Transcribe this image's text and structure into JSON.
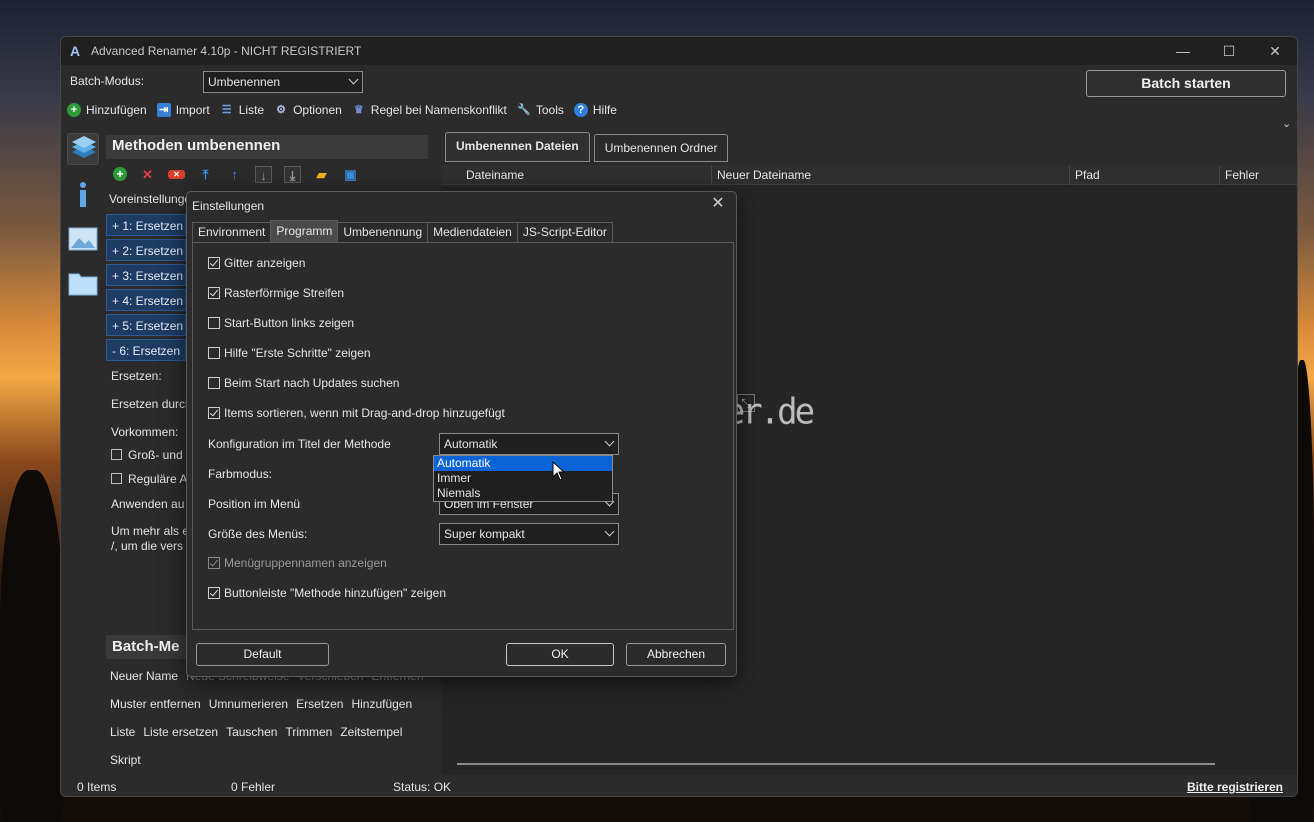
{
  "window": {
    "title": "Advanced Renamer 4.10p - NICHT REGISTRIERT",
    "controls": {
      "minimize": "—",
      "maximize": "☐",
      "close": "✕"
    }
  },
  "batch_mode": {
    "label": "Batch-Modus:",
    "value": "Umbenennen"
  },
  "batch_start_label": "Batch starten",
  "toolbar": [
    {
      "label": "Hinzufügen",
      "icon": "plus-circle-icon",
      "color": "#2e9b3a"
    },
    {
      "label": "Import",
      "icon": "import-icon",
      "color": "#3a7fd6"
    },
    {
      "label": "Liste",
      "icon": "list-icon",
      "color": "#3a7fd6"
    },
    {
      "label": "Optionen",
      "icon": "gear-icon",
      "color": "#8aa0c8"
    },
    {
      "label": "Regel bei Namenskonflikt",
      "icon": "rule-icon",
      "color": "#6a8fd0"
    },
    {
      "label": "Tools",
      "icon": "wrench-icon",
      "color": "#a0a0a0"
    },
    {
      "label": "Hilfe",
      "icon": "help-icon",
      "color": "#2f7fe0"
    }
  ],
  "methods_panel": {
    "header": "Methoden umbenennen",
    "presets_label": "Voreinstellunge",
    "method_rows": [
      "+ 1: Ersetzen",
      "+ 2: Ersetzen",
      "+ 3: Ersetzen",
      "+ 4: Ersetzen",
      "+ 5: Ersetzen",
      "- 6: Ersetzen"
    ],
    "fields": {
      "replace": "Ersetzen:",
      "replace_with": "Ersetzen durch",
      "occurrences": "Vorkommen:",
      "case_sensitive": "Groß- und",
      "regex": "Reguläre A",
      "apply_to": "Anwenden au",
      "hint_line1": "Um mehr als e",
      "hint_line2": "/, um die vers"
    }
  },
  "batch_methods": {
    "header": "Batch-Me",
    "rows": [
      [
        "Neuer Name",
        "Neue Schreibweise",
        "Verschieben",
        "Entfernen"
      ],
      [
        "Muster entfernen",
        "Umnumerieren",
        "Ersetzen",
        "Hinzufügen"
      ],
      [
        "Liste",
        "Liste ersetzen",
        "Tauschen",
        "Trimmen",
        "Zeitstempel"
      ],
      [
        "Skript"
      ]
    ]
  },
  "right_tabs": [
    "Umbenennen Dateien",
    "Umbenennen Ordner"
  ],
  "list_columns": [
    "Dateiname",
    "Neuer Dateiname",
    "Pfad",
    "Fehler"
  ],
  "statusbar": {
    "items": "0 Items",
    "errors": "0 Fehler",
    "status": "Status: OK",
    "register": "Bitte registrieren"
  },
  "watermark": "Deskmodder.de",
  "dialog": {
    "title": "Einstellungen",
    "tabs": [
      "Environment",
      "Programm",
      "Umbenennung",
      "Mediendateien",
      "JS-Script-Editor"
    ],
    "active_tab": "Programm",
    "options": [
      {
        "label": "Gitter anzeigen",
        "checked": true,
        "disabled": false
      },
      {
        "label": "Rasterförmige Streifen",
        "checked": true,
        "disabled": false
      },
      {
        "label": "Start-Button links zeigen",
        "checked": false,
        "disabled": false
      },
      {
        "label": "Hilfe \"Erste Schritte\" zeigen",
        "checked": false,
        "disabled": false
      },
      {
        "label": "Beim Start nach Updates suchen",
        "checked": false,
        "disabled": false
      },
      {
        "label": "Items sortieren, wenn mit Drag-and-drop hinzugefügt",
        "checked": true,
        "disabled": false
      }
    ],
    "selects": {
      "config_in_title": {
        "label": "Konfiguration im Titel der Methode",
        "value": "Automatik"
      },
      "color_mode": {
        "label": "Farbmodus:"
      },
      "menu_position": {
        "label": "Position im Menü",
        "value": "Oben im Fenster"
      },
      "menu_size": {
        "label": "Größe des Menüs:",
        "value": "Super kompakt"
      }
    },
    "dropdown_options": [
      "Automatik",
      "Immer",
      "Niemals"
    ],
    "dropdown_selected": "Automatik",
    "options_bottom": [
      {
        "label": "Menügruppennamen anzeigen",
        "checked": true,
        "disabled": true
      },
      {
        "label": "Buttonleiste \"Methode hinzufügen\" zeigen",
        "checked": true,
        "disabled": false
      }
    ],
    "buttons": {
      "default": "Default",
      "ok": "OK",
      "cancel": "Abbrechen"
    }
  }
}
